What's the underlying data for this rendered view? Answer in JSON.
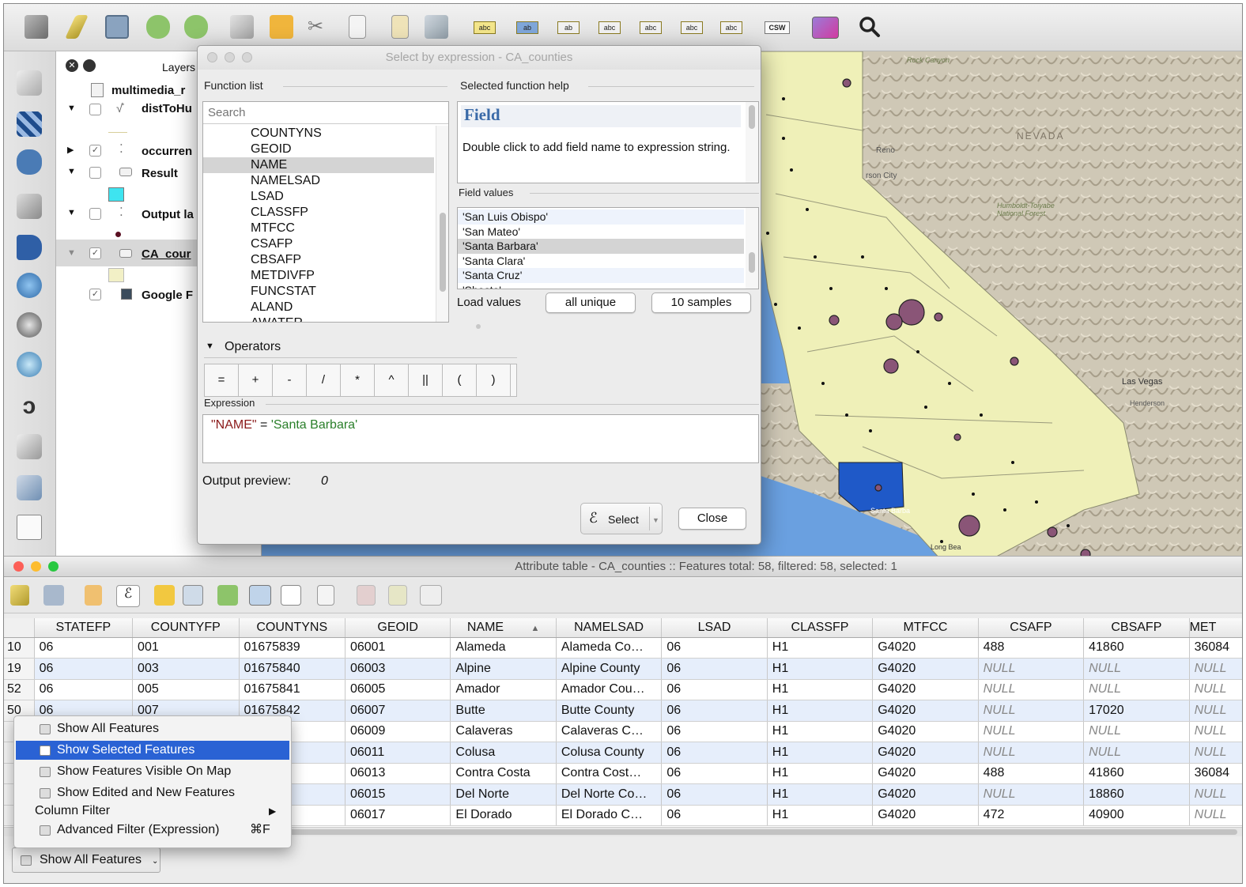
{
  "layers_panel": {
    "title": "Layers",
    "items": [
      {
        "name": "multimedia_r"
      },
      {
        "name": "distToHu"
      },
      {
        "name": "occurren"
      },
      {
        "name": "Result"
      },
      {
        "name": "Output la"
      },
      {
        "name": "CA_cour"
      },
      {
        "name": "Google F"
      }
    ]
  },
  "toolbar": {
    "csw_label": "CSW",
    "label_buttons": [
      "abc",
      "ab",
      "ab",
      "abc",
      "abc",
      "abc",
      "abc"
    ]
  },
  "map_labels": {
    "nevada": "NEVADA",
    "reno": "Reno",
    "las_vegas": "Las Vegas",
    "henderson": "Henderson",
    "santa_barbara": "Santa Barba",
    "long_beach": "Long Bea",
    "carson_city": "rson City",
    "humboldt": "Humboldt-Toiyabe National Forest",
    "rock_canyon": "Rock Canyon"
  },
  "dialog": {
    "title": "Select by expression - CA_counties",
    "function_list_label": "Function list",
    "search_placeholder": "Search",
    "functions": [
      "COUNTYNS",
      "GEOID",
      "NAME",
      "NAMELSAD",
      "LSAD",
      "CLASSFP",
      "MTFCC",
      "CSAFP",
      "CBSAFP",
      "METDIVFP",
      "FUNCSTAT",
      "ALAND",
      "AWATER"
    ],
    "selected_function": "NAME",
    "help_label": "Selected function help",
    "help_title": "Field",
    "help_text": "Double click to add field name to expression string.",
    "field_values_label": "Field values",
    "field_values": [
      "'San Luis Obispo'",
      "'San Mateo'",
      "'Santa Barbara'",
      "'Santa Clara'",
      "'Santa Cruz'",
      "'Shasta'"
    ],
    "selected_value": "'Santa Barbara'",
    "load_values_label": "Load values",
    "all_unique": "all unique",
    "ten_samples": "10 samples",
    "operators_label": "Operators",
    "operators": [
      "=",
      "+",
      "-",
      "/",
      "*",
      "^",
      "||",
      "(",
      ")"
    ],
    "expression_label": "Expression",
    "expression_field": "\"NAME\"",
    "expression_op": " = ",
    "expression_value": "'Santa Barbara'",
    "output_preview_label": "Output preview:",
    "output_preview_value": "0",
    "select_button": "Select",
    "close_button": "Close"
  },
  "attribute_table": {
    "title": "Attribute table - CA_counties :: Features total: 58, filtered: 58, selected: 1",
    "columns": [
      "STATEFP",
      "COUNTYFP",
      "COUNTYNS",
      "GEOID",
      "NAME",
      "NAMELSAD",
      "LSAD",
      "CLASSFP",
      "MTFCC",
      "CSAFP",
      "CBSAFP",
      "MET"
    ],
    "sort_indicator": "▲",
    "rows": [
      {
        "rh": "10",
        "c": [
          "06",
          "001",
          "01675839",
          "06001",
          "Alameda",
          "Alameda Co…",
          "06",
          "H1",
          "G4020",
          "488",
          "41860",
          "36084"
        ]
      },
      {
        "rh": "19",
        "c": [
          "06",
          "003",
          "01675840",
          "06003",
          "Alpine",
          "Alpine County",
          "06",
          "H1",
          "G4020",
          "NULL",
          "NULL",
          "NULL"
        ]
      },
      {
        "rh": "52",
        "c": [
          "06",
          "005",
          "01675841",
          "06005",
          "Amador",
          "Amador Cou…",
          "06",
          "H1",
          "G4020",
          "NULL",
          "NULL",
          "NULL"
        ]
      },
      {
        "rh": "50",
        "c": [
          "06",
          "007",
          "01675842",
          "06007",
          "Butte",
          "Butte County",
          "06",
          "H1",
          "G4020",
          "NULL",
          "17020",
          "NULL"
        ]
      },
      {
        "rh": "",
        "c": [
          "",
          "",
          "885",
          "06009",
          "Calaveras",
          "Calaveras C…",
          "06",
          "H1",
          "G4020",
          "NULL",
          "NULL",
          "NULL"
        ]
      },
      {
        "rh": "",
        "c": [
          "",
          "",
          "902",
          "06011",
          "Colusa",
          "Colusa County",
          "06",
          "H1",
          "G4020",
          "NULL",
          "NULL",
          "NULL"
        ]
      },
      {
        "rh": "",
        "c": [
          "",
          "",
          "903",
          "06013",
          "Contra Costa",
          "Contra Cost…",
          "06",
          "H1",
          "G4020",
          "488",
          "41860",
          "36084"
        ]
      },
      {
        "rh": "",
        "c": [
          "",
          "",
          "074",
          "06015",
          "Del Norte",
          "Del Norte Co…",
          "06",
          "H1",
          "G4020",
          "NULL",
          "18860",
          "NULL"
        ]
      },
      {
        "rh": "",
        "c": [
          "",
          "",
          "273",
          "06017",
          "El Dorado",
          "El Dorado C…",
          "06",
          "H1",
          "G4020",
          "472",
          "40900",
          "NULL"
        ]
      }
    ],
    "filter_button": "Show All Features"
  },
  "context_menu": {
    "items": [
      "Show All Features",
      "Show Selected Features",
      "Show Features Visible On Map",
      "Show Edited and New Features",
      "Column Filter",
      "Advanced Filter (Expression)"
    ],
    "shortcut": "⌘F",
    "submenu_arrow": "▶"
  },
  "colors": {
    "map_land": "#eff0b8",
    "ocean": "#6aa0e0",
    "selected_county": "#1f59c8",
    "point_fill": "#8a5577",
    "accent_select": "#2a62d4"
  }
}
